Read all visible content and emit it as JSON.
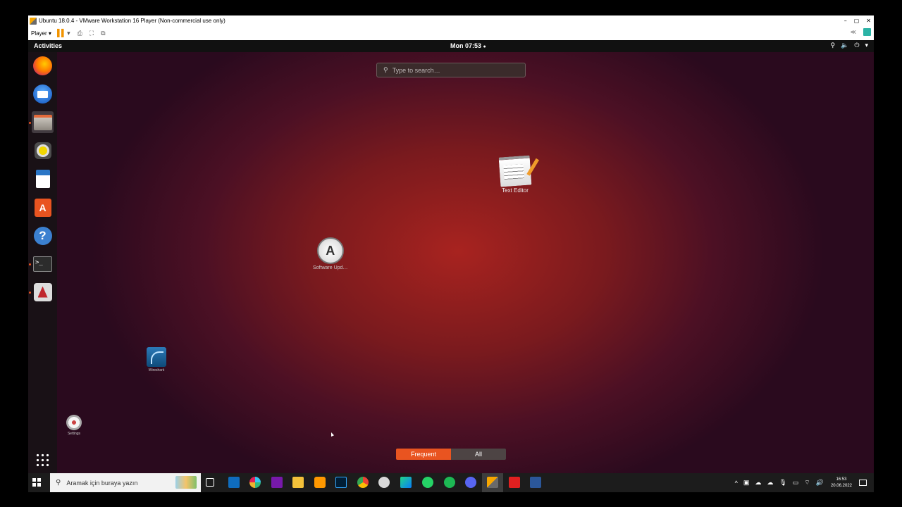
{
  "vm": {
    "title": "Ubuntu 18.0.4 - VMware Workstation 16 Player (Non-commercial use only)",
    "player_menu": "Player",
    "controls": {
      "minimize": "–",
      "restore": "▢",
      "close": "✕"
    }
  },
  "ubuntu": {
    "top_bar": {
      "activities": "Activities",
      "clock": "Mon 07:53",
      "clock_dot": "●",
      "indicators": [
        "network-icon",
        "volume-icon",
        "power-icon",
        "chevron-down-icon"
      ]
    },
    "dock": {
      "items": [
        {
          "name": "firefox",
          "running": false
        },
        {
          "name": "thunderbird",
          "running": false
        },
        {
          "name": "files",
          "running": true,
          "active": true
        },
        {
          "name": "rhythmbox",
          "running": false
        },
        {
          "name": "libreoffice-writer",
          "running": false
        },
        {
          "name": "ubuntu-software",
          "running": false
        },
        {
          "name": "help",
          "running": false
        },
        {
          "name": "terminal",
          "running": true
        },
        {
          "name": "steam",
          "running": true
        }
      ],
      "show_apps": "show-applications"
    },
    "search": {
      "placeholder": "Type to search…"
    },
    "apps": {
      "text_editor": "Text Editor",
      "software_updater": "Software Upd…",
      "wireshark": "Wireshark",
      "settings": "Settings"
    },
    "view_switch": {
      "frequent": "Frequent",
      "all": "All"
    }
  },
  "windows_taskbar": {
    "search_placeholder": "Aramak için buraya yazın",
    "pinned": [
      "task-view",
      "outlook",
      "slack",
      "onenote",
      "file-explorer",
      "sublime-text",
      "photoshop",
      "chrome",
      "vpn",
      "pycharm",
      "whatsapp",
      "spotify",
      "discord",
      "vmware",
      "acrobat",
      "word"
    ],
    "clock": {
      "time": "16:53",
      "date": "20.06.2022"
    }
  },
  "colors": {
    "ubuntu_orange": "#e95420",
    "desktop_bg": "#7a1a1e",
    "taskbar": "#1c1c1c"
  }
}
